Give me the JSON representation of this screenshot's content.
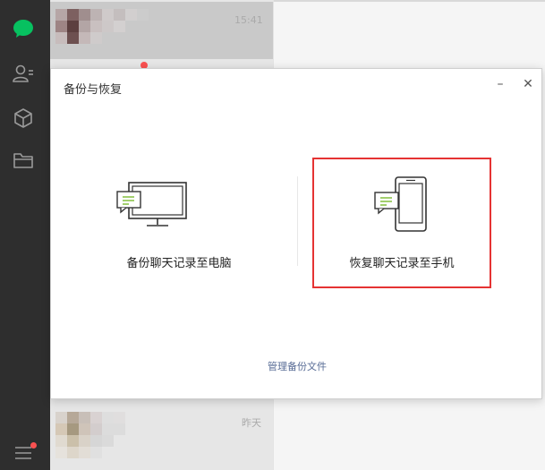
{
  "dialog": {
    "title": "备份与恢复",
    "minimize_glyph": "–",
    "close_glyph": "✕",
    "backup_option_label": "备份聊天记录至电脑",
    "backup_option_icon": "monitor-chat-icon",
    "restore_option_label": "恢复聊天记录至手机",
    "restore_option_icon": "phone-chat-icon",
    "manage_link_label": "管理备份文件"
  },
  "chat_list": {
    "items": [
      {
        "time": "15:41",
        "active": true
      },
      {
        "time": "昨天",
        "active": false
      }
    ]
  },
  "sidebar": {
    "icons": [
      "chat-icon",
      "contacts-icon",
      "cube-icon",
      "folder-icon",
      "menu-icon"
    ]
  },
  "colors": {
    "sidebar_bg": "#2e2e2e",
    "chat_icon_green": "#07c160",
    "notification_red": "#fa5151",
    "highlight_border": "#e53333",
    "link_blue": "#576b95",
    "chat_bubble_green": "#8bc34a"
  }
}
